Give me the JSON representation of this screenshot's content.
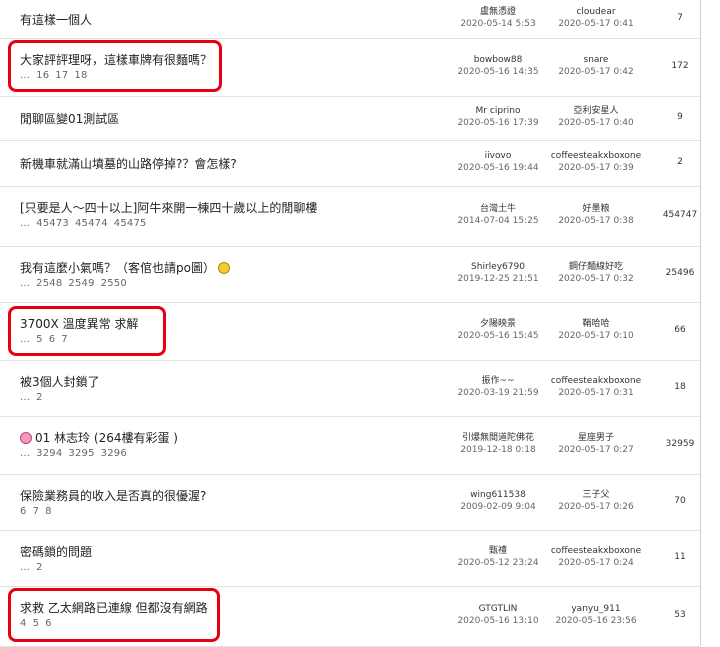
{
  "threads": [
    {
      "title": "有這樣一個人",
      "pages": [],
      "author": "盧無憑證",
      "author_date": "2020-05-14 5:53",
      "last": "cloudear",
      "last_date": "2020-05-17 0:41",
      "replies": "7",
      "emoji": ""
    },
    {
      "title": "大家評評理呀，這樣車牌有很麵嗎？",
      "pages": [
        "...",
        "16",
        "17",
        "18"
      ],
      "author": "bowbow88",
      "author_date": "2020-05-16 14:35",
      "last": "snare",
      "last_date": "2020-05-17 0:42",
      "replies": "172",
      "emoji": ""
    },
    {
      "title": "閒聊區變01測試區",
      "pages": [],
      "author": "Mr ciprino",
      "author_date": "2020-05-16 17:39",
      "last": "亞利安星人",
      "last_date": "2020-05-17 0:40",
      "replies": "9",
      "emoji": ""
    },
    {
      "title": "新機車就滿山墳墓的山路停掉?？會怎樣?",
      "pages": [],
      "author": "iivovo",
      "author_date": "2020-05-16 19:44",
      "last": "coffeesteakxboxone",
      "last_date": "2020-05-17 0:39",
      "replies": "2",
      "emoji": ""
    },
    {
      "title": "[只要是人～四十以上]阿牛來開一棟四十歲以上的閒聊樓",
      "pages": [
        "...",
        "45473",
        "45474",
        "45475"
      ],
      "author": "台灣土牛",
      "author_date": "2014-07-04 15:25",
      "last": "好墨粮",
      "last_date": "2020-05-17 0:38",
      "replies": "454747",
      "emoji": ""
    },
    {
      "title": "我有這麼小氣嗎？（客倌也請po圖）",
      "pages": [
        "...",
        "2548",
        "2549",
        "2550"
      ],
      "author": "Shirley6790",
      "author_date": "2019-12-25 21:51",
      "last": "鋼仔麵線好吃",
      "last_date": "2020-05-17 0:32",
      "replies": "25496",
      "emoji": "smile"
    },
    {
      "title": "3700X 溫度異常 求解",
      "pages": [
        "...",
        "5",
        "6",
        "7"
      ],
      "author": "夕陽映景",
      "author_date": "2020-05-16 15:45",
      "last": "鞘哈哈",
      "last_date": "2020-05-17 0:10",
      "replies": "66",
      "emoji": ""
    },
    {
      "title": "被3個人封鎖了",
      "pages": [
        "...",
        "2"
      ],
      "author": "振作~~",
      "author_date": "2020-03-19 21:59",
      "last": "coffeesteakxboxone",
      "last_date": "2020-05-17 0:31",
      "replies": "18",
      "emoji": ""
    },
    {
      "title": "01 林志玲 (264樓有彩蛋 )",
      "pages": [
        "...",
        "3294",
        "3295",
        "3296"
      ],
      "author": "引爆無間道陀佛花",
      "author_date": "2019-12-18 0:18",
      "last": "星座男子",
      "last_date": "2020-05-17 0:27",
      "replies": "32959",
      "emoji": "flower"
    },
    {
      "title": "保險業務員的收入是否真的很優渥?",
      "pages": [
        "6",
        "7",
        "8"
      ],
      "author": "wing611538",
      "author_date": "2009-02-09 9:04",
      "last": "三子父",
      "last_date": "2020-05-17 0:26",
      "replies": "70",
      "emoji": ""
    },
    {
      "title": "密碼鎖的問題",
      "pages": [
        "...",
        "2"
      ],
      "author": "甄禮",
      "author_date": "2020-05-12 23:24",
      "last": "coffeesteakxboxone",
      "last_date": "2020-05-17 0:24",
      "replies": "11",
      "emoji": ""
    },
    {
      "title": "求救 乙太網路已連線 但都沒有網路",
      "pages": [
        "4",
        "5",
        "6"
      ],
      "author": "GTGTLIN",
      "author_date": "2020-05-16 13:10",
      "last": "yanyu_911",
      "last_date": "2020-05-16 23:56",
      "replies": "53",
      "emoji": ""
    }
  ]
}
